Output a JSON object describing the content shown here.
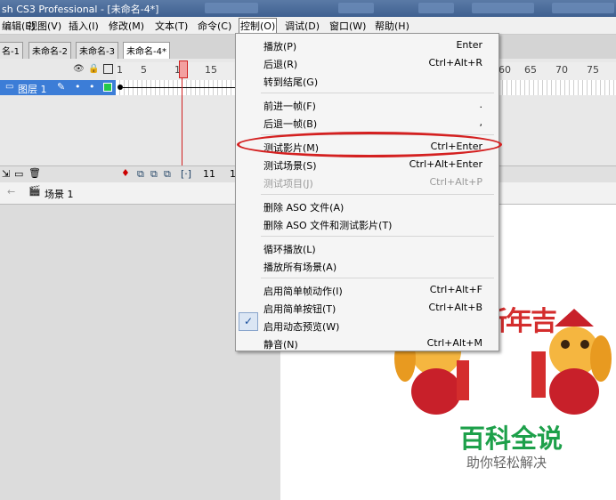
{
  "window": {
    "title": "sh CS3 Professional - [未命名-4*]"
  },
  "menubar": {
    "items": [
      "编辑(E)",
      "视图(V)",
      "插入(I)",
      "修改(M)",
      "文本(T)",
      "命令(C)",
      "控制(O)",
      "调试(D)",
      "窗口(W)",
      "帮助(H)"
    ],
    "active": "控制(O)"
  },
  "tabs": [
    "名-1",
    "未命名-2",
    "未命名-3",
    "未命名-4*"
  ],
  "timeline": {
    "layer_name": "图层 1",
    "ruler_numbers": [
      "1",
      "5",
      "10",
      "15",
      "60",
      "65",
      "70",
      "75"
    ],
    "current_frame": "11",
    "bottom_partial": "1"
  },
  "scene": {
    "label": "场景 1"
  },
  "control_menu": {
    "groups": [
      [
        {
          "label": "播放(P)",
          "shortcut": "Enter"
        },
        {
          "label": "后退(R)",
          "shortcut": "Ctrl+Alt+R"
        },
        {
          "label": "转到结尾(G)",
          "shortcut": ""
        }
      ],
      [
        {
          "label": "前进一帧(F)",
          "shortcut": "."
        },
        {
          "label": "后退一帧(B)",
          "shortcut": ","
        }
      ],
      [
        {
          "label": "测试影片(M)",
          "shortcut": "Ctrl+Enter",
          "highlighted": true
        },
        {
          "label": "测试场景(S)",
          "shortcut": "Ctrl+Alt+Enter"
        },
        {
          "label": "测试项目(J)",
          "shortcut": "Ctrl+Alt+P",
          "disabled": true
        }
      ],
      [
        {
          "label": "删除 ASO 文件(A)",
          "shortcut": ""
        },
        {
          "label": "删除 ASO 文件和测试影片(T)",
          "shortcut": ""
        }
      ],
      [
        {
          "label": "循环播放(L)",
          "shortcut": ""
        },
        {
          "label": "播放所有场景(A)",
          "shortcut": ""
        }
      ],
      [
        {
          "label": "启用简单帧动作(I)",
          "shortcut": "Ctrl+Alt+F"
        },
        {
          "label": "启用简单按钮(T)",
          "shortcut": "Ctrl+Alt+B"
        },
        {
          "label": "启用动态预览(W)",
          "shortcut": "",
          "checked": true
        },
        {
          "label": "静音(N)",
          "shortcut": "Ctrl+Alt+M"
        }
      ]
    ]
  },
  "stage_art": {
    "text": "新年吉"
  },
  "watermark": {
    "title": "百科全说",
    "subtitle": "助你轻松解决"
  },
  "colors": {
    "highlight_ring": "#d42020",
    "layer_selected": "#3c7dd7",
    "watermark_green": "#1da04a"
  }
}
